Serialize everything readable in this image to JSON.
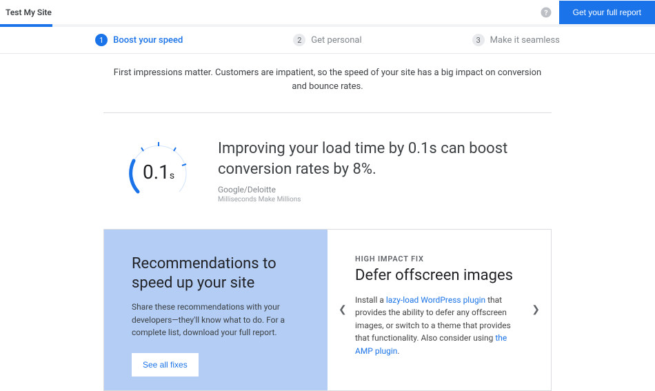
{
  "header": {
    "title": "Test My Site",
    "cta": "Get your full report"
  },
  "tabs": [
    {
      "num": "1",
      "label": "Boost your speed",
      "active": true
    },
    {
      "num": "2",
      "label": "Get personal",
      "active": false
    },
    {
      "num": "3",
      "label": "Make it seamless",
      "active": false
    }
  ],
  "intro": "First impressions matter. Customers are impatient, so the speed of your site has a big impact on conversion and bounce rates.",
  "stat": {
    "gauge_value": "0.1",
    "gauge_unit": "s",
    "headline": "Improving your load time by 0.1s can boost conversion rates by 8%.",
    "source1": "Google/Deloitte",
    "source2": "Milliseconds Make Millions"
  },
  "recommend_card": {
    "title": "Recommendations to speed up your site",
    "body": "Share these recommendations with your developers—they'll know what to do. For a complete list, download your full report.",
    "button": "See all fixes"
  },
  "fix_card": {
    "overline": "HIGH IMPACT FIX",
    "title": "Defer offscreen images",
    "body_pre": "Install a ",
    "link1": "lazy-load WordPress plugin",
    "body_mid": " that provides the ability to defer any offscreen images, or switch to a theme that provides that functionality. Also consider using ",
    "link2": "the AMP plugin",
    "body_post": "."
  }
}
